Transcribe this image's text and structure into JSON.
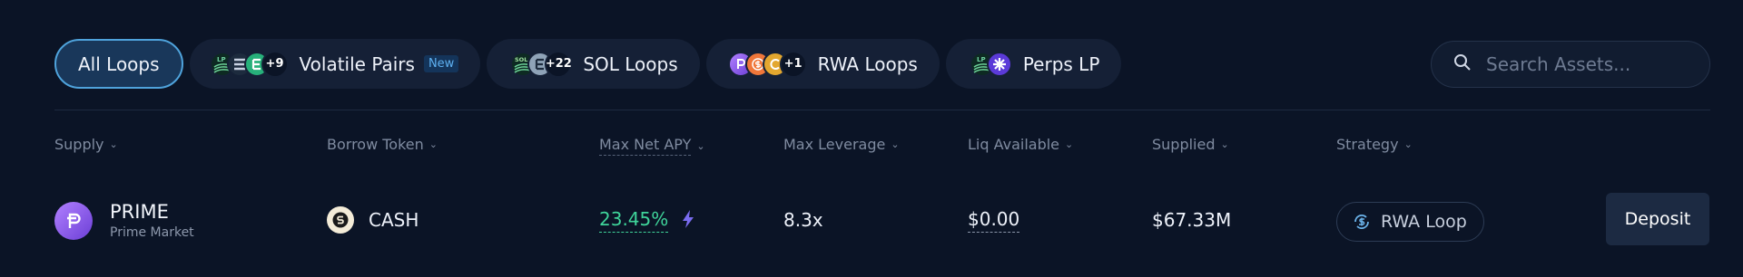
{
  "tabs": [
    {
      "label": "All Loops",
      "active": true
    },
    {
      "label": "Volatile Pairs",
      "badge": "New",
      "extra_count": "+9",
      "icon_text": "LP"
    },
    {
      "label": "SOL Loops",
      "extra_count": "+22",
      "icon_text": "SOL"
    },
    {
      "label": "RWA Loops",
      "extra_count": "+1"
    },
    {
      "label": "Perps LP",
      "icon_text": "LP"
    }
  ],
  "search": {
    "placeholder": "Search Assets..."
  },
  "columns": [
    "Supply",
    "Borrow Token",
    "Max Net APY",
    "Max Leverage",
    "Liq Available",
    "Supplied",
    "Strategy"
  ],
  "row": {
    "supply_name": "PRIME",
    "supply_sub": "Prime Market",
    "borrow_token": "CASH",
    "max_net_apy": "23.45%",
    "max_leverage": "8.3x",
    "liq_available": "$0.00",
    "supplied": "$67.33M",
    "strategy": "RWA Loop",
    "action": "Deposit"
  },
  "colors": {
    "accent": "#4fa3dc",
    "positive": "#3fd49a",
    "background": "#0b1426",
    "lightning": "#7a6cf0"
  }
}
